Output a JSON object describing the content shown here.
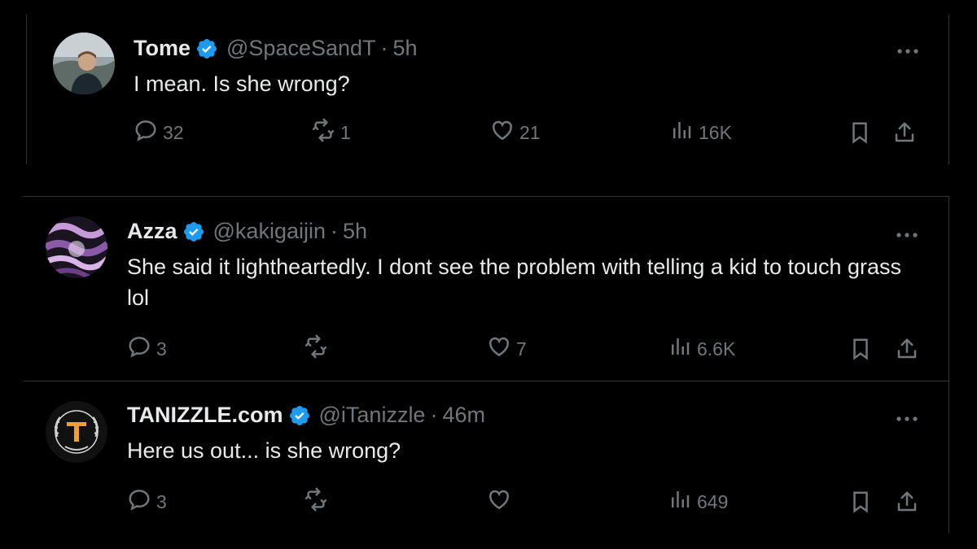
{
  "tweets": [
    {
      "name": "Tome",
      "handle": "@SpaceSandT",
      "separator": "·",
      "time": "5h",
      "text": "I mean. Is she wrong?",
      "replies": "32",
      "retweets": "1",
      "likes": "21",
      "views": "16K"
    },
    {
      "name": "Azza",
      "handle": "@kakigaijin",
      "separator": "·",
      "time": "5h",
      "text": "She said it lightheartedly. I dont see the problem with telling a kid to touch grass lol",
      "replies": "3",
      "retweets": "",
      "likes": "7",
      "views": "6.6K"
    },
    {
      "name": "TANIZZLE.com",
      "handle": "@iTanizzle",
      "separator": "·",
      "time": "46m",
      "text": "Here us out... is she wrong?",
      "replies": "3",
      "retweets": "",
      "likes": "",
      "views": "649"
    }
  ],
  "colors": {
    "background": "#000000",
    "verified": "#1d9bf0",
    "muted": "#71767b",
    "text": "#e7e9ea",
    "border": "#2f3336"
  },
  "icons": [
    "verified-badge-icon",
    "more-icon",
    "reply-icon",
    "retweet-icon",
    "like-icon",
    "views-icon",
    "bookmark-icon",
    "share-icon"
  ]
}
